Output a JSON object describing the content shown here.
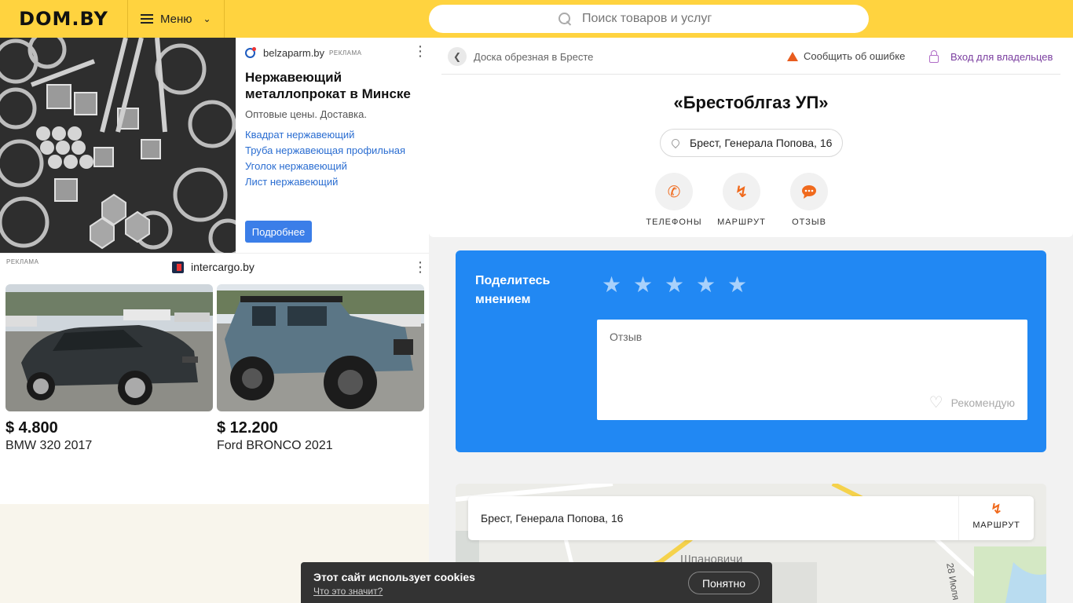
{
  "header": {
    "logo": "DOM.BY",
    "menu_label": "Меню",
    "search_placeholder": "Поиск товаров и услуг"
  },
  "ad_top": {
    "source": "belzaparm.by",
    "tag": "РЕКЛАМА",
    "title": "Нержавеющий металлопрокат в Минске",
    "subtitle": "Оптовые цены. Доставка.",
    "links": [
      "Квадрат нержавеющий",
      "Труба нержавеющая профильная",
      "Уголок нержавеющий",
      "Лист нержавеющий"
    ],
    "button": "Подробнее"
  },
  "ad_cars": {
    "tag": "РЕКЛАМА",
    "source": "intercargo.by",
    "cars": [
      {
        "price": "$ 4.800",
        "name": "BMW 320 2017"
      },
      {
        "price": "$ 12.200",
        "name": "Ford BRONCO 2021"
      }
    ]
  },
  "card": {
    "breadcrumb": "Доска обрезная в Бресте",
    "report": "Сообщить об ошибке",
    "owners": "Вход для владельцев",
    "title": "«Брестоблгаз УП»",
    "address": "Брест, Генерала Попова, 16",
    "actions": [
      "ТЕЛЕФОНЫ",
      "МАРШРУТ",
      "ОТЗЫВ"
    ]
  },
  "review": {
    "title": "Поделитесь мнением",
    "placeholder": "Отзыв",
    "recommend": "Рекомендую",
    "rating": 0
  },
  "map": {
    "address": "Брест, Генерала Попова, 16",
    "route": "МАРШРУТ",
    "labels": [
      "Шпановичи",
      "28 Июля"
    ]
  },
  "cookie": {
    "text": "Этот сайт использует cookies",
    "link": "Что это значит?",
    "button": "Понятно"
  },
  "colors": {
    "header": "#ffd33f",
    "review_bg": "#2188f3",
    "accent_orange": "#f06a1d",
    "link_blue": "#2a6dd1"
  }
}
